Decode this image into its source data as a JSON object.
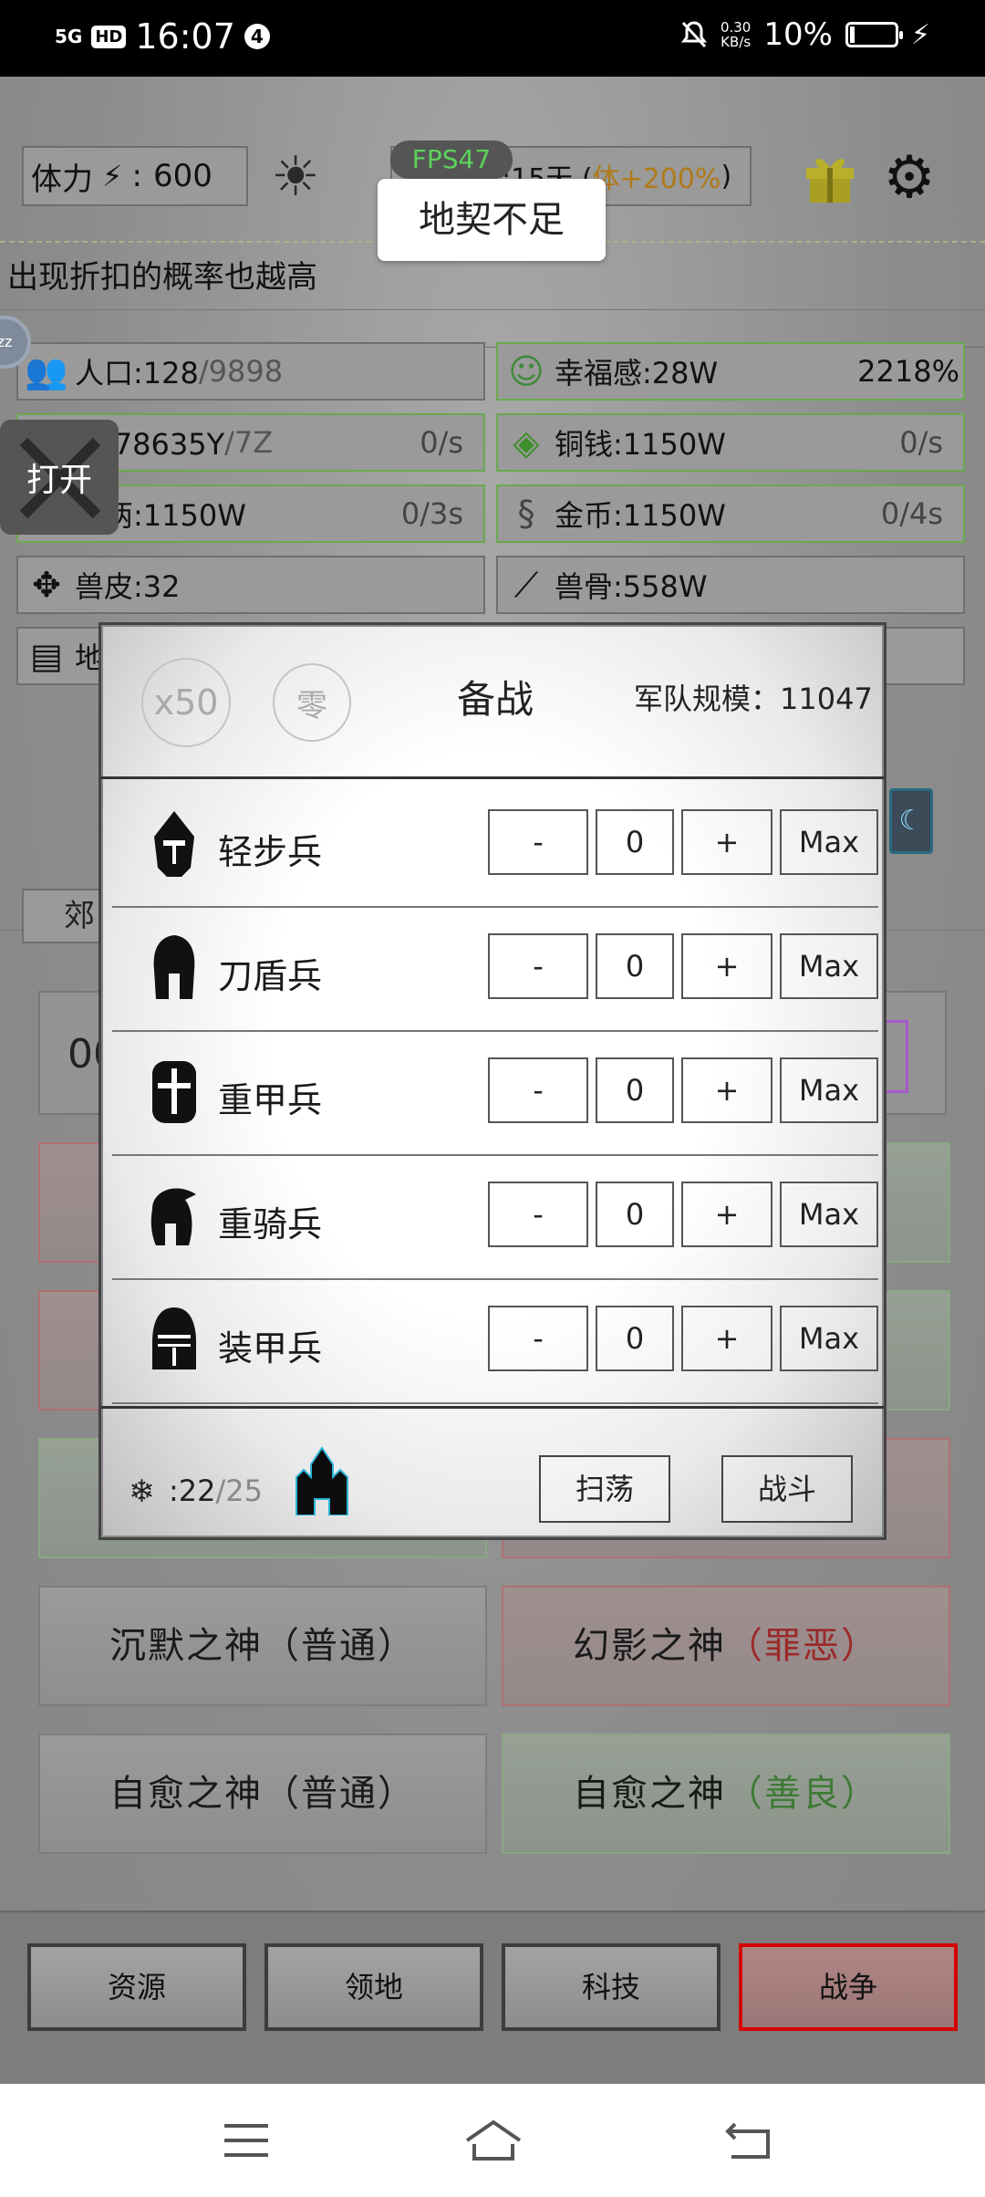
{
  "status_bar": {
    "signal": "5G",
    "hd": "HD",
    "time": "16:07",
    "notification_count": "4",
    "speed_value": "0.30",
    "speed_unit": "KB/s",
    "battery": "10%",
    "battery_level": 0.1
  },
  "top_bar": {
    "stamina_label": "体力",
    "stamina_sep": ":",
    "stamina_value": "600",
    "fps": "FPS47",
    "season_text": "秋:15天 (",
    "season_bonus": "体+200%",
    "season_close": ")"
  },
  "toast": "地契不足",
  "ticker": "出现折扣的概率也越高",
  "open_button": "打开",
  "resources": [
    {
      "label": "人口:128",
      "max": "/9898",
      "right": ""
    },
    {
      "label": "幸福感:28W",
      "max": "",
      "right": "2218%"
    },
    {
      "label": "只:78635Y",
      "max": "/7Z",
      "right": "0/s"
    },
    {
      "label": "铜钱:1150W",
      "max": "",
      "right": "0/s"
    },
    {
      "label": "银两:1150W",
      "max": "",
      "right": "0/3s"
    },
    {
      "label": "金币:1150W",
      "max": "",
      "right": "0/4s"
    },
    {
      "label": "兽皮:32",
      "max": "",
      "right": ""
    },
    {
      "label": "兽骨:558W",
      "max": "",
      "right": ""
    },
    {
      "label": "地",
      "max": "",
      "right": ""
    }
  ],
  "mid": {
    "tab": "郊",
    "counter": "00"
  },
  "gods": [
    {
      "name": "沉默之神",
      "quality": "（普通）",
      "type": "normal"
    },
    {
      "name": "幻影之神",
      "quality": "（罪恶）",
      "type": "evil"
    },
    {
      "name": "自愈之神",
      "quality": "（普通）",
      "type": "normal"
    },
    {
      "name": "自愈之神",
      "quality": "（善良）",
      "type": "good"
    }
  ],
  "bottom_nav": [
    "资源",
    "领地",
    "科技",
    "战争"
  ],
  "modal": {
    "multiplier": "x50",
    "zero": "零",
    "title": "备战",
    "army_label": "军队规模：",
    "army_value": "11047",
    "units": [
      {
        "name": "轻步兵",
        "value": "0"
      },
      {
        "name": "刀盾兵",
        "value": "0"
      },
      {
        "name": "重甲兵",
        "value": "0"
      },
      {
        "name": "重骑兵",
        "value": "0"
      },
      {
        "name": "装甲兵",
        "value": "0"
      }
    ],
    "minus": "-",
    "plus": "+",
    "max": "Max",
    "count_current": ":22",
    "count_max": "/25",
    "sweep": "扫荡",
    "fight": "战斗"
  }
}
